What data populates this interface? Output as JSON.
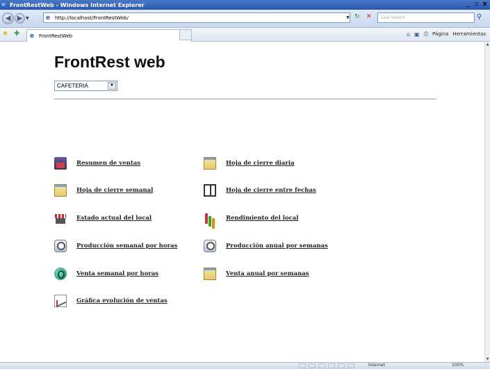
{
  "window": {
    "title": "FrontRestWeb - Windows Internet Explorer",
    "min": "_",
    "max": "é",
    "close": "x"
  },
  "address": {
    "url": "http://localhost/FrontRestWeb/",
    "search_placeholder": "Live Search"
  },
  "tab": {
    "label": "FrontRestWeb"
  },
  "commands": {
    "page": "Página",
    "tools": "Herramientas"
  },
  "page": {
    "heading": "FrontRest web",
    "location_select": "CAFETERIA"
  },
  "menu": {
    "left": [
      {
        "label": "Resumen de ventas",
        "icon": "cash-register-icon"
      },
      {
        "label": "Hoja de cierre semanal",
        "icon": "calendar-sheet-icon"
      },
      {
        "label": "Estado actual del local",
        "icon": "storefront-icon"
      },
      {
        "label": "Producción semanal por horas",
        "icon": "clock-icon"
      },
      {
        "label": "Venta semanal por horas",
        "icon": "globe-clock-icon"
      },
      {
        "label": "Gráfica evolución de ventas",
        "icon": "line-chart-icon"
      }
    ],
    "right": [
      {
        "label": "Hoja de cierre diaria",
        "icon": "daily-sheet-icon"
      },
      {
        "label": "Hoja de cierre entre fechas",
        "icon": "date-range-book-icon"
      },
      {
        "label": "Rendimiento del local",
        "icon": "bar-chart-icon"
      },
      {
        "label": "Producción anual por semanas",
        "icon": "clock-icon"
      },
      {
        "label": "Venta anual por semanas",
        "icon": "calendar-sheet-icon"
      }
    ]
  },
  "status": {
    "zone": "Internet",
    "zoom": "100%"
  }
}
